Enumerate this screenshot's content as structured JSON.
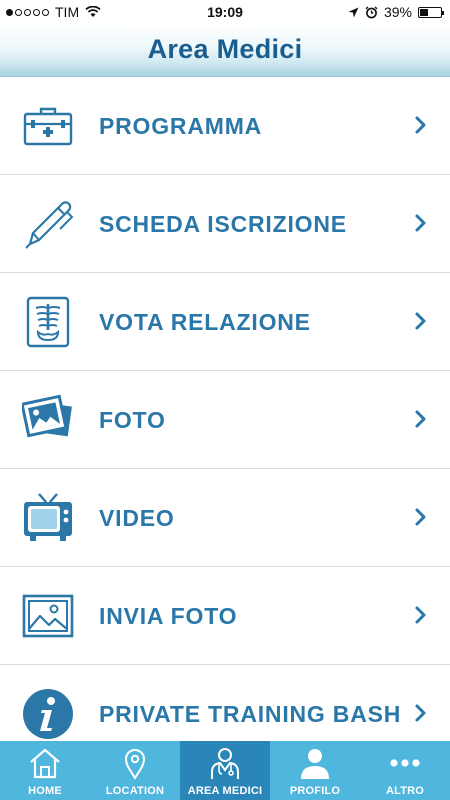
{
  "status_bar": {
    "carrier": "TIM",
    "time": "19:09",
    "battery": "39%",
    "battery_level": 0.39,
    "signal_bars": 1
  },
  "nav": {
    "title": "Area Medici"
  },
  "menu": {
    "items": [
      {
        "label": "PROGRAMMA",
        "icon": "medical-kit-icon"
      },
      {
        "label": "SCHEDA ISCRIZIONE",
        "icon": "pen-icon"
      },
      {
        "label": "VOTA RELAZIONE",
        "icon": "xray-icon"
      },
      {
        "label": "FOTO",
        "icon": "photos-icon"
      },
      {
        "label": "VIDEO",
        "icon": "tv-icon"
      },
      {
        "label": "INVIA FOTO",
        "icon": "picture-icon"
      },
      {
        "label": "PRIVATE TRAINING BASH",
        "icon": "info-icon"
      }
    ]
  },
  "tabs": [
    {
      "label": "HOME",
      "icon": "home-icon",
      "active": false
    },
    {
      "label": "LOCATION",
      "icon": "location-pin-icon",
      "active": false
    },
    {
      "label": "AREA MEDICI",
      "icon": "doctor-icon",
      "active": true
    },
    {
      "label": "PROFILO",
      "icon": "person-icon",
      "active": false
    },
    {
      "label": "ALTRO",
      "icon": "more-icon",
      "active": false
    }
  ],
  "colors": {
    "accent": "#2b77a8",
    "title": "#1a5d8f",
    "tab_bar": "#4fb6de",
    "tab_active": "#2a86b8"
  }
}
